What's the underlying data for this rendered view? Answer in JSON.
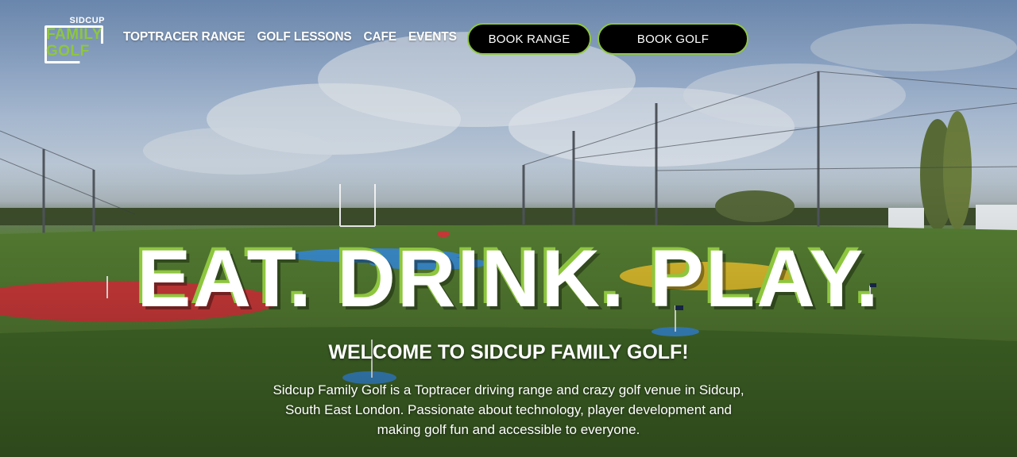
{
  "brand": {
    "logo_top": "SIDCUP",
    "logo_line1": "FAMILY",
    "logo_line2": "GOLF",
    "accent_color": "#8ec63f"
  },
  "nav": {
    "items": [
      {
        "label": "TOPTRACER RANGE"
      },
      {
        "label": "GOLF LESSONS"
      },
      {
        "label": "CAFE"
      },
      {
        "label": "EVENTS"
      }
    ],
    "book_range_label": "BOOK RANGE",
    "book_golf_label": "BOOK GOLF"
  },
  "hero": {
    "headline": "EAT. DRINK. PLAY.",
    "welcome": "WELCOME TO SIDCUP FAMILY GOLF!",
    "description": "Sidcup Family Golf is a Toptracer driving range and crazy golf venue in Sidcup, South East London. Passionate about technology, player development and making golf fun and accessible to everyone."
  }
}
